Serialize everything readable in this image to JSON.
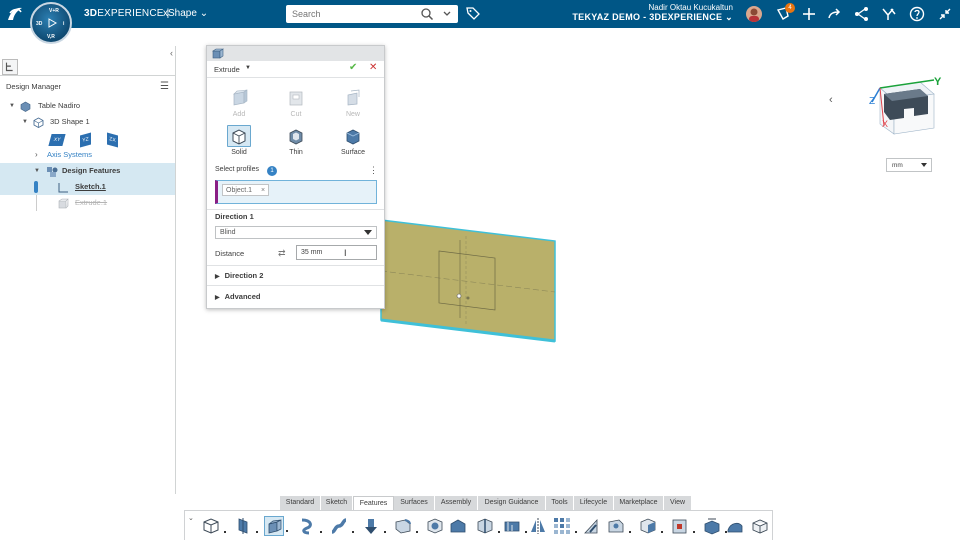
{
  "topbar": {
    "brand_bold": "3D",
    "brand_rest": "EXPERIENCE",
    "separator": "|",
    "app_name": "xShape",
    "search_placeholder": "Search",
    "user_name": "Nadir Oktau Kucukaltun",
    "company": "TEKYAZ DEMO - 3DEXPERIENCE",
    "notification_count": "4",
    "compass_labels": {
      "top": "V+R",
      "left": "3D",
      "right": "i",
      "bottom": "V,R"
    }
  },
  "left_panel": {
    "title": "Design Manager",
    "tree": [
      {
        "label": "Table Nadiro",
        "icon": "product-icon"
      },
      {
        "label": "3D Shape 1",
        "icon": "shape-icon"
      },
      {
        "label": "Axis Systems",
        "icon": "chevron-right-icon"
      },
      {
        "label": "Design Features",
        "icon": "features-icon"
      },
      {
        "label": "Sketch.1",
        "icon": "sketch-icon"
      },
      {
        "label": "Extrude.1",
        "icon": "extrude-icon"
      }
    ],
    "plane_labels": [
      "XY",
      "YZ",
      "ZX"
    ]
  },
  "extrude_panel": {
    "title": "Extrude",
    "ops_row1": [
      "Add",
      "Cut",
      "New"
    ],
    "ops_row2": [
      "Solid",
      "Thin",
      "Surface"
    ],
    "select_profiles_label": "Select profiles",
    "select_profiles_count": "1",
    "profile_chip": "Object.1",
    "direction1_label": "Direction 1",
    "direction1_type": "Blind",
    "distance_label": "Distance",
    "distance_value": "35 mm",
    "direction2_label": "Direction 2",
    "advanced_label": "Advanced"
  },
  "viewport": {
    "units": "mm",
    "axis_y": "Y",
    "axis_x": "X",
    "axis_z": "Z"
  },
  "bottom_tabs": [
    "Standard",
    "Sketch",
    "Features",
    "Surfaces",
    "Assembly",
    "Design Guidance",
    "Tools",
    "Lifecycle",
    "Marketplace",
    "View"
  ],
  "active_tab": "Features",
  "colors": {
    "topbar": "#005686",
    "plate_fill": "#b9b06a",
    "plate_edge": "#3fc0d8",
    "accent": "#3582c4"
  }
}
